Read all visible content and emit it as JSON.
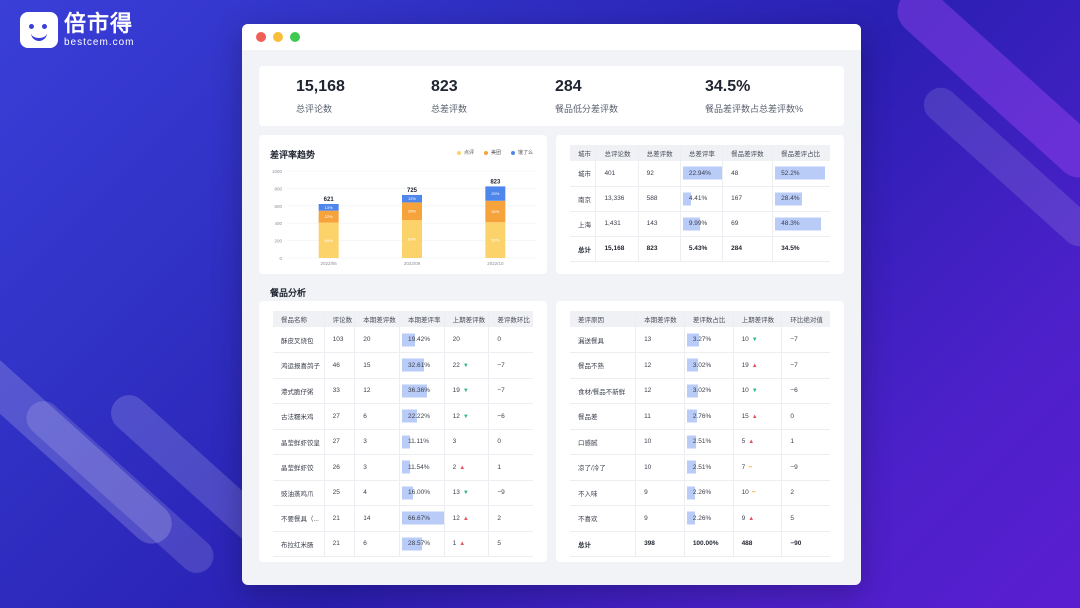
{
  "brand": {
    "name": "倍市得",
    "sub": "bestcem.com"
  },
  "kpis": [
    {
      "value": "15,168",
      "label": "总评论数"
    },
    {
      "value": "823",
      "label": "总差评数"
    },
    {
      "value": "284",
      "label": "餐品低分差评数"
    },
    {
      "value": "34.5%",
      "label": "餐品差评数占总差评数%"
    }
  ],
  "colors": {
    "series1": "#fcd26a",
    "series2": "#f7a33b",
    "series3": "#4f86ec",
    "bar": "#b9cbf7"
  },
  "chart_data": {
    "type": "bar",
    "title": "差评率趋势",
    "categories": [
      "2022/06",
      "2022/09",
      "2022/10"
    ],
    "series": [
      {
        "name": "点评",
        "values": [
          407,
          436,
          411
        ],
        "labels": [
          "65%",
          "60%",
          "50%"
        ]
      },
      {
        "name": "美团",
        "values": [
          137,
          203,
          247
        ],
        "labels": [
          "22%",
          "28%",
          "30%"
        ]
      },
      {
        "name": "饿了么",
        "values": [
          77,
          86,
          165
        ],
        "labels": [
          "13%",
          "12%",
          "20%"
        ]
      }
    ],
    "totals": [
      "621",
      "725",
      "823"
    ],
    "ylim": [
      0,
      1000
    ],
    "yticks": [
      "0",
      "200",
      "400",
      "600",
      "800",
      "1000"
    ],
    "legend": "top-right",
    "grid": true
  },
  "city_table": {
    "headers": [
      "城市",
      "总评论数",
      "总差评数",
      "总差评率",
      "餐品差评数",
      "餐品差评占比"
    ],
    "rows": [
      {
        "city": "城市",
        "total": "401",
        "neg": "92",
        "rate": "22.94%",
        "rate_val": 22.94,
        "food": "48",
        "share": "52.2%",
        "share_val": 52.2
      },
      {
        "city": "南京",
        "total": "13,336",
        "neg": "588",
        "rate": "4.41%",
        "rate_val": 4.41,
        "food": "167",
        "share": "28.4%",
        "share_val": 28.4
      },
      {
        "city": "上海",
        "total": "1,431",
        "neg": "143",
        "rate": "9.99%",
        "rate_val": 9.99,
        "food": "69",
        "share": "48.3%",
        "share_val": 48.3
      }
    ],
    "total": {
      "city": "总计",
      "total": "15,168",
      "neg": "823",
      "rate": "5.43%",
      "food": "284",
      "share": "34.5%"
    }
  },
  "section_title": "餐品分析",
  "dish_table": {
    "headers": [
      "餐品名称",
      "评论数",
      "本期差评数",
      "本期差评率",
      "上期差评数",
      "差评数环比"
    ],
    "rows": [
      {
        "name": "酥皮叉烧包",
        "reviews": "103",
        "neg": "20",
        "rate": "19.42%",
        "rate_val": 19.42,
        "prev": "20",
        "trend": "",
        "mom": "0"
      },
      {
        "name": "鸿运报喜鸽子",
        "reviews": "46",
        "neg": "15",
        "rate": "32.61%",
        "rate_val": 32.61,
        "prev": "22",
        "trend": "down",
        "mom": "−7"
      },
      {
        "name": "港式脆仔粥",
        "reviews": "33",
        "neg": "12",
        "rate": "36.36%",
        "rate_val": 36.36,
        "prev": "19",
        "trend": "down",
        "mom": "−7"
      },
      {
        "name": "古法糯米鸡",
        "reviews": "27",
        "neg": "6",
        "rate": "22.22%",
        "rate_val": 22.22,
        "prev": "12",
        "trend": "down",
        "mom": "−6"
      },
      {
        "name": "晶莹鲜虾饺皇",
        "reviews": "27",
        "neg": "3",
        "rate": "11.11%",
        "rate_val": 11.11,
        "prev": "3",
        "trend": "",
        "mom": "0"
      },
      {
        "name": "晶莹鲜虾饺",
        "reviews": "26",
        "neg": "3",
        "rate": "11.54%",
        "rate_val": 11.54,
        "prev": "2",
        "trend": "up",
        "mom": "1"
      },
      {
        "name": "豉油蒸鸡爪",
        "reviews": "25",
        "neg": "4",
        "rate": "16.00%",
        "rate_val": 16.0,
        "prev": "13",
        "trend": "down",
        "mom": "−9"
      },
      {
        "name": "不要餐具（...",
        "reviews": "21",
        "neg": "14",
        "rate": "66.67%",
        "rate_val": 66.67,
        "prev": "12",
        "trend": "up",
        "mom": "2"
      },
      {
        "name": "布拉红米肠",
        "reviews": "21",
        "neg": "6",
        "rate": "28.57%",
        "rate_val": 28.57,
        "prev": "1",
        "trend": "up",
        "mom": "5"
      }
    ]
  },
  "reason_table": {
    "headers": [
      "差评原因",
      "本期差评数",
      "差评数占比",
      "上期差评数",
      "环比绝对值"
    ],
    "rows": [
      {
        "reason": "漏送餐具",
        "neg": "13",
        "share": "3.27%",
        "share_val": 3.27,
        "prev": "10",
        "trend": "down",
        "abs": "−7"
      },
      {
        "reason": "餐品不熟",
        "neg": "12",
        "share": "3.02%",
        "share_val": 3.02,
        "prev": "19",
        "trend": "up",
        "abs": "−7"
      },
      {
        "reason": "食材/餐品不新鲜",
        "neg": "12",
        "share": "3.02%",
        "share_val": 3.02,
        "prev": "10",
        "trend": "down",
        "abs": "−6"
      },
      {
        "reason": "餐品差",
        "neg": "11",
        "share": "2.76%",
        "share_val": 2.76,
        "prev": "15",
        "trend": "up",
        "abs": "0"
      },
      {
        "reason": "口感腻",
        "neg": "10",
        "share": "2.51%",
        "share_val": 2.51,
        "prev": "5",
        "trend": "up",
        "abs": "1"
      },
      {
        "reason": "凉了/冷了",
        "neg": "10",
        "share": "2.51%",
        "share_val": 2.51,
        "prev": "7",
        "trend": "flat",
        "abs": "−9"
      },
      {
        "reason": "不入味",
        "neg": "9",
        "share": "2.26%",
        "share_val": 2.26,
        "prev": "10",
        "trend": "flat",
        "abs": "2"
      },
      {
        "reason": "不喜欢",
        "neg": "9",
        "share": "2.26%",
        "share_val": 2.26,
        "prev": "9",
        "trend": "up",
        "abs": "5"
      }
    ],
    "total": {
      "reason": "总计",
      "neg": "398",
      "share": "100.00%",
      "prev": "488",
      "abs": "−90"
    }
  }
}
